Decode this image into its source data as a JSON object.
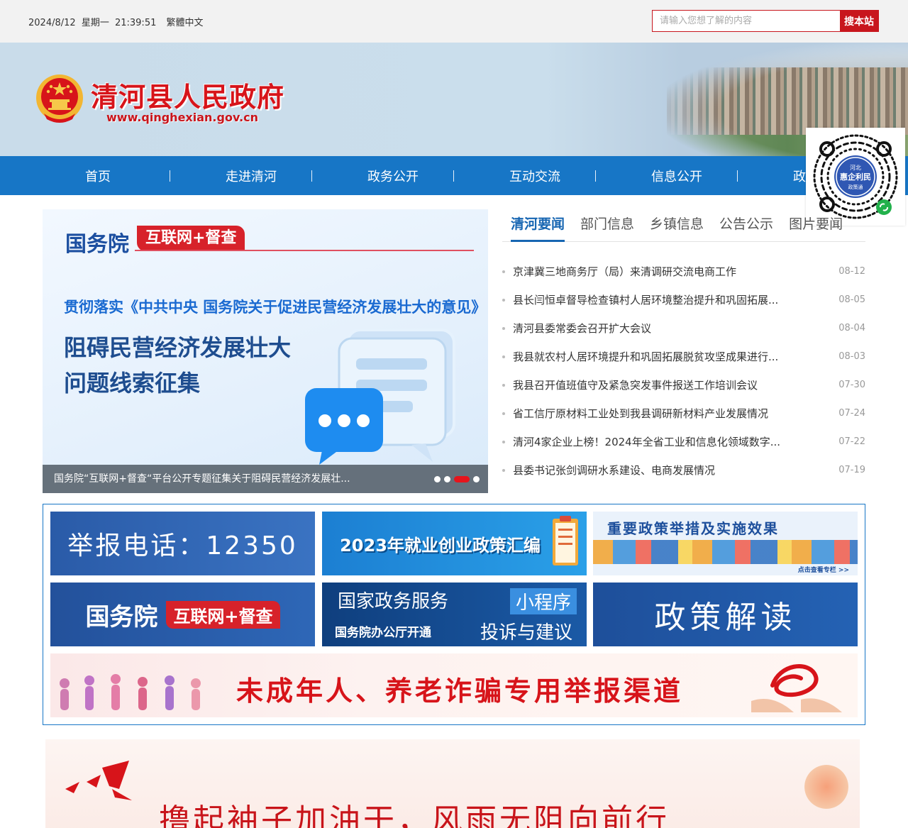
{
  "topbar": {
    "date": "2024/8/12",
    "weekday": "星期一",
    "time": "21:39:51",
    "lang_toggle": "繁體中文",
    "search_placeholder": "请输入您想了解的内容",
    "search_button": "搜本站"
  },
  "header": {
    "site_title": "清河县人民政府",
    "site_url": "www.qinghexian.gov.cn"
  },
  "nav": {
    "items": [
      "首页",
      "走进清河",
      "政务公开",
      "互动交流",
      "信息公开",
      "政务"
    ]
  },
  "qr": {
    "line1": "河北",
    "line2": "惠企利民",
    "line3": "政策通"
  },
  "slide": {
    "heading": "国务院",
    "badge": "互联网+督查",
    "subtitle": "贯彻落实《中共中央 国务院关于促进民营经济发展壮大的意见》",
    "line1": "阻碍民营经济发展壮大",
    "line2": "问题线索征集",
    "caption": "国务院“互联网+督查“平台公开专题征集关于阻碍民营经济发展壮...",
    "dots_total": 4,
    "dots_active_index": 2
  },
  "news": {
    "tabs": [
      "清河要闻",
      "部门信息",
      "乡镇信息",
      "公告公示",
      "图片要闻"
    ],
    "active_tab": 0,
    "items": [
      {
        "title": "京津冀三地商务厅（局）来清调研交流电商工作",
        "date": "08-12"
      },
      {
        "title": "县长闫恒卓督导检查镇村人居环境整治提升和巩固拓展...",
        "date": "08-05"
      },
      {
        "title": "清河县委常委会召开扩大会议",
        "date": "08-04"
      },
      {
        "title": "我县就农村人居环境提升和巩固拓展脱贫攻坚成果进行...",
        "date": "08-03"
      },
      {
        "title": "我县召开值班值守及紧急突发事件报送工作培训会议",
        "date": "07-30"
      },
      {
        "title": "省工信厅原材料工业处到我县调研新材料产业发展情况",
        "date": "07-24"
      },
      {
        "title": "清河4家企业上榜！2024年全省工业和信息化领域数字...",
        "date": "07-22"
      },
      {
        "title": "县委书记张剑调研水系建设、电商发展情况",
        "date": "07-19"
      }
    ]
  },
  "tiles": {
    "report_phone": "举报电话：12350",
    "employment": "2023年就业创业政策汇编",
    "policy_effect": "重要政策举措及实施效果",
    "policy_effect_sub": "点击查看专栏 >>",
    "gov_a": "国务院",
    "gov_b": "互联网+督查",
    "service_l1": "国家政务服务",
    "service_l2": "国务院办公厅开通",
    "service_r1": "小程序",
    "service_r2": "投诉与建议",
    "policy_read": "政策解读",
    "wide": "未成年人、养老诈骗专用举报渠道"
  },
  "bottom": {
    "slogan": "撸起袖子加油干，风雨无阻向前行"
  },
  "colors": {
    "nav_blue": "#1776c6",
    "accent_red": "#c8161d",
    "title_red": "#d7141a"
  }
}
